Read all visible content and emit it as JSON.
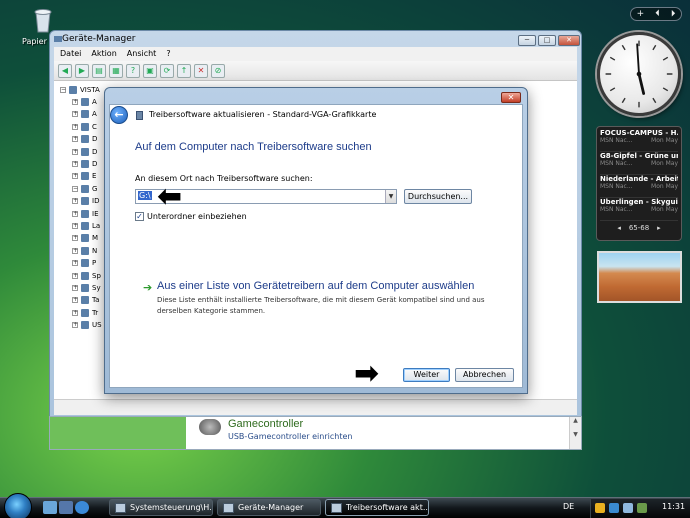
{
  "desktop": {
    "recycle_label": "Papier"
  },
  "sidebar": {
    "controls": [
      "+",
      "⏴",
      "⏵"
    ],
    "feeds": [
      {
        "title": "FOCUS-CAMPUS - H...",
        "source": "MSN Nac...",
        "date": "Mon May"
      },
      {
        "title": "G8-Gipfel - Grüne un...",
        "source": "MSN Nac...",
        "date": "Mon May"
      },
      {
        "title": "Niederlande - Arbeit...",
        "source": "MSN Nac...",
        "date": "Mon May"
      },
      {
        "title": "Überlingen - Skyguid...",
        "source": "MSN Nac...",
        "date": "Mon May"
      }
    ],
    "feed_nav": {
      "prev": "◂",
      "range": "65-68",
      "next": "▸"
    }
  },
  "device_manager": {
    "title": "Geräte-Manager",
    "menu": [
      "Datei",
      "Aktion",
      "Ansicht",
      "?"
    ],
    "tree_root": "VISTA",
    "tree_items": [
      "A",
      "A",
      "C",
      "D",
      "D",
      "D",
      "E",
      "G",
      "ID",
      "IE",
      "La",
      "M",
      "N",
      "P",
      "Sp",
      "Sy",
      "Ta",
      "Tr",
      "US"
    ]
  },
  "control_panel": {
    "item_title": "Gamecontroller",
    "item_subtitle": "USB-Gamecontroller einrichten"
  },
  "wizard": {
    "title": "Treibersoftware aktualisieren - Standard-VGA-Grafikkarte",
    "heading": "Auf dem Computer nach Treibersoftware suchen",
    "path_label": "An diesem Ort nach Treibersoftware suchen:",
    "path_value": "G:\\",
    "browse_label": "Durchsuchen...",
    "subfolders_label": "Unterordner einbeziehen",
    "list_link": "Aus einer Liste von Gerätetreibern auf dem Computer auswählen",
    "list_desc": "Diese Liste enthält installierte Treibersoftware, die mit diesem Gerät kompatibel sind und aus derselben Kategorie stammen.",
    "next_label": "Weiter",
    "cancel_label": "Abbrechen"
  },
  "taskbar": {
    "tasks": [
      "Systemsteuerung\\H...",
      "Geräte-Manager",
      "Treibersoftware akt..."
    ],
    "language": "DE",
    "time": "11:31"
  },
  "colors": {
    "accent": "#1d3c8a",
    "link_green": "#2d9a2d"
  }
}
